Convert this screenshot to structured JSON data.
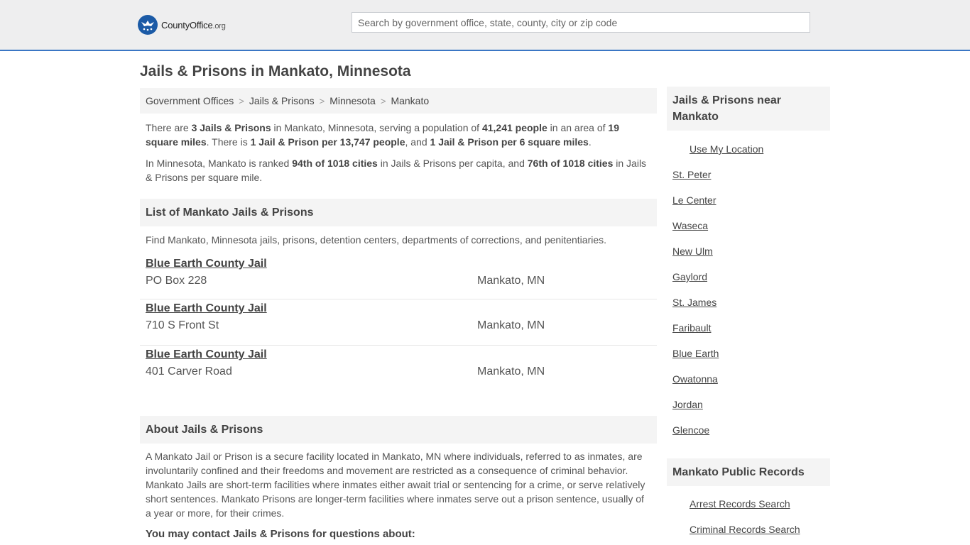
{
  "header": {
    "logo_text": "CountyOffice",
    "logo_tld": ".org",
    "search_placeholder": "Search by government office, state, county, city or zip code"
  },
  "page_title": "Jails & Prisons in Mankato, Minnesota",
  "breadcrumb": [
    "Government Offices",
    "Jails & Prisons",
    "Minnesota",
    "Mankato"
  ],
  "intro": {
    "p1": [
      {
        "t": "There are ",
        "b": false
      },
      {
        "t": "3 Jails & Prisons",
        "b": true
      },
      {
        "t": " in Mankato, Minnesota, serving a population of ",
        "b": false
      },
      {
        "t": "41,241 people",
        "b": true
      },
      {
        "t": " in an area of ",
        "b": false
      },
      {
        "t": "19 square miles",
        "b": true
      },
      {
        "t": ". There is ",
        "b": false
      },
      {
        "t": "1 Jail & Prison per 13,747 people",
        "b": true
      },
      {
        "t": ", and ",
        "b": false
      },
      {
        "t": "1 Jail & Prison per 6 square miles",
        "b": true
      },
      {
        "t": ".",
        "b": false
      }
    ],
    "p2": [
      {
        "t": "In Minnesota, Mankato is ranked ",
        "b": false
      },
      {
        "t": "94th of 1018 cities",
        "b": true
      },
      {
        "t": " in Jails & Prisons per capita, and ",
        "b": false
      },
      {
        "t": "76th of 1018 cities",
        "b": true
      },
      {
        "t": " in Jails & Prisons per square mile.",
        "b": false
      }
    ]
  },
  "list_section": {
    "heading": "List of Mankato Jails & Prisons",
    "description": "Find Mankato, Minnesota jails, prisons, detention centers, departments of corrections, and penitentiaries.",
    "items": [
      {
        "name": "Blue Earth County Jail",
        "address": "PO Box 228",
        "city": "Mankato, MN"
      },
      {
        "name": "Blue Earth County Jail",
        "address": "710 S Front St",
        "city": "Mankato, MN"
      },
      {
        "name": "Blue Earth County Jail",
        "address": "401 Carver Road",
        "city": "Mankato, MN"
      }
    ]
  },
  "about_section": {
    "heading": "About Jails & Prisons",
    "text": "A Mankato Jail or Prison is a secure facility located in Mankato, MN where individuals, referred to as inmates, are involuntarily confined and their freedoms and movement are restricted as a consequence of criminal behavior. Mankato Jails are short-term facilities where inmates either await trial or sentencing for a crime, or serve relatively short sentences. Mankato Prisons are longer-term facilities where inmates serve out a prison sentence, usually of a year or more, for their crimes.",
    "contact_heading": "You may contact Jails & Prisons for questions about:"
  },
  "sidebar": {
    "near_heading": "Jails & Prisons near Mankato",
    "use_location": "Use My Location",
    "nearby": [
      "St. Peter",
      "Le Center",
      "Waseca",
      "New Ulm",
      "Gaylord",
      "St. James",
      "Faribault",
      "Blue Earth",
      "Owatonna",
      "Jordan",
      "Glencoe"
    ],
    "records_heading": "Mankato Public Records",
    "records": [
      "Arrest Records Search",
      "Criminal Records Search"
    ]
  },
  "colors": {
    "header_bg": "#eeeeef",
    "header_border": "#3a76c4",
    "logo_blue": "#1b5aa6",
    "section_bg": "#f4f4f4",
    "text": "#444444"
  }
}
